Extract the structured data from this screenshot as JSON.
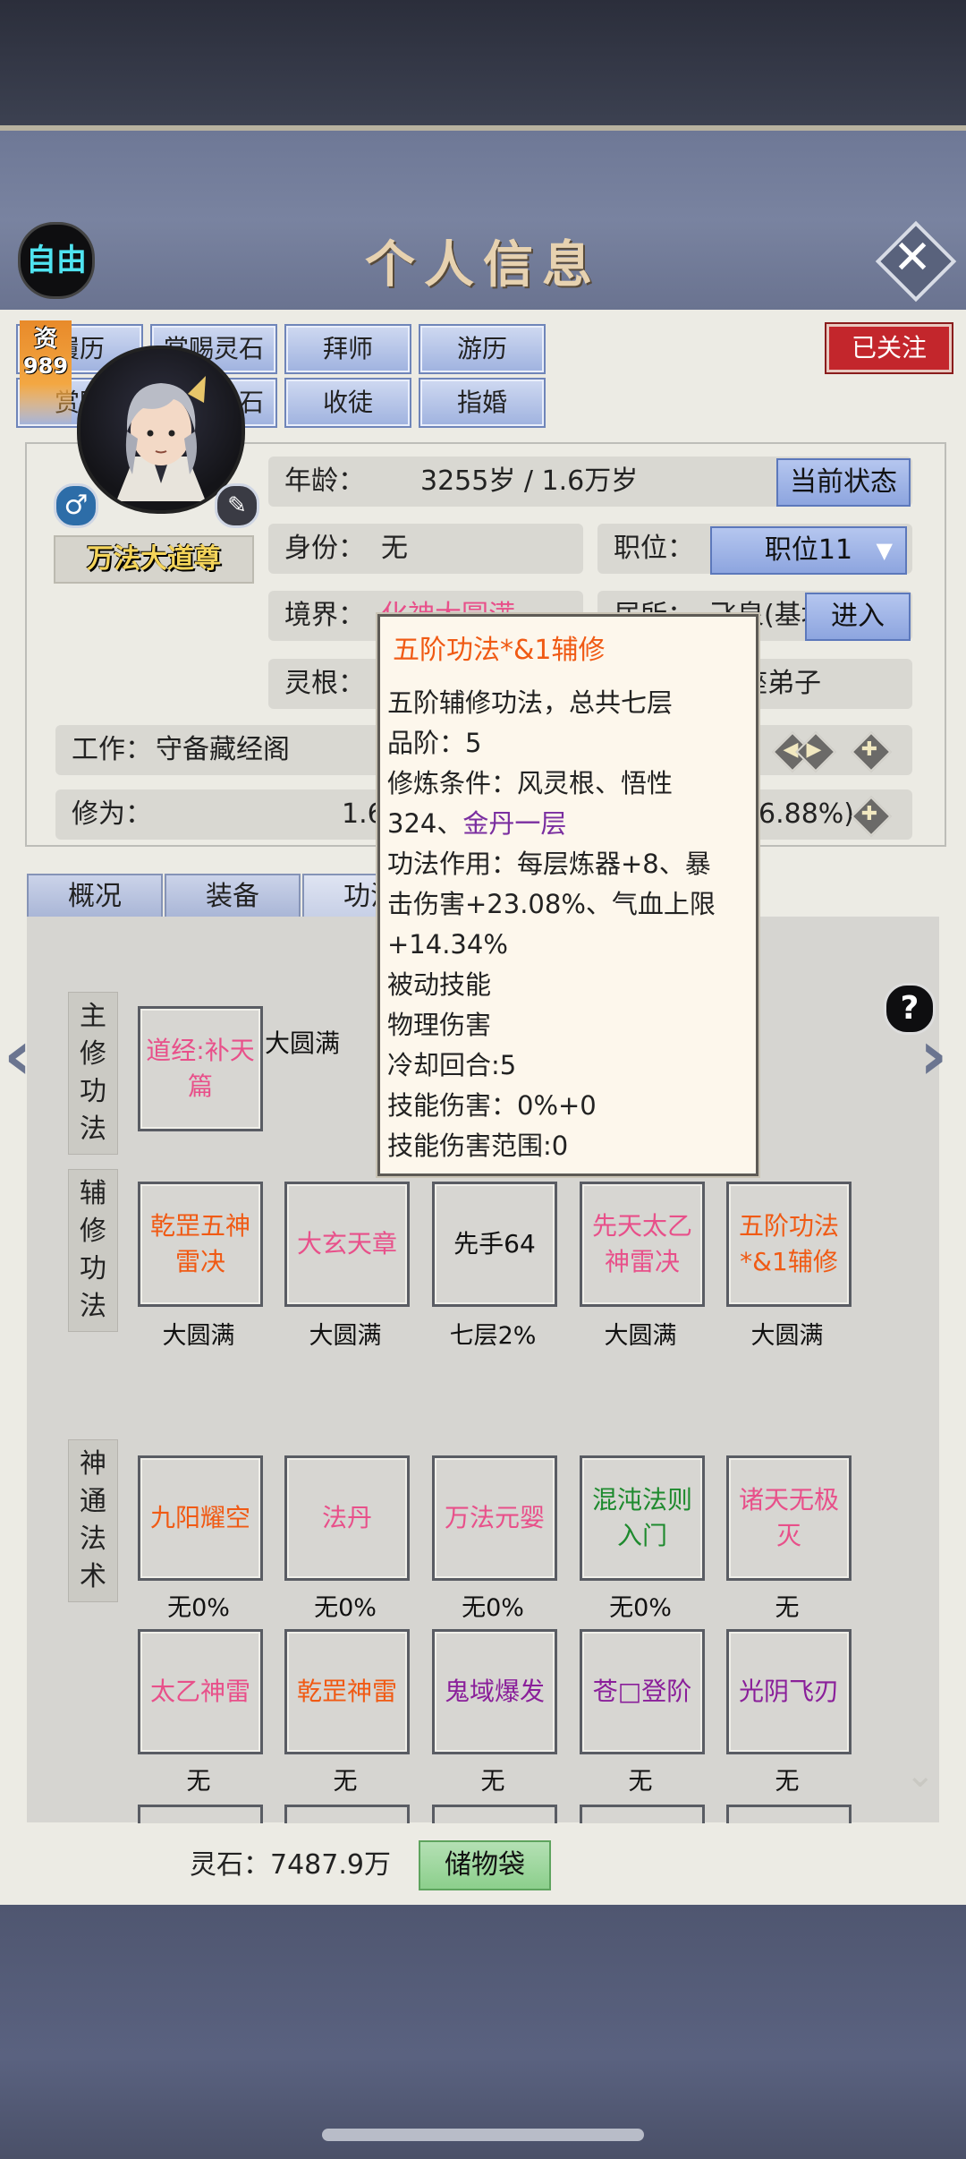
{
  "header": {
    "title": "个人信息",
    "freedom_label": "自由",
    "close_label": "✕"
  },
  "action_buttons": {
    "row1": [
      "履历",
      "赏赐灵石",
      "拜师",
      "游历"
    ],
    "row2": [
      "赏赐",
      "没收灵石",
      "收徒",
      "指婚"
    ],
    "follow": "已关注"
  },
  "profile": {
    "resource_label": "资",
    "resource_value": "989",
    "name": "万法大道尊",
    "gender_icon": "male-icon",
    "age_label": "年龄：",
    "age_value": "3255岁 / 1.6万岁",
    "status_button": "当前状态",
    "identity_label": "身份：",
    "identity_value": "无",
    "position_label": "职位：",
    "position_value": "职位11",
    "realm_label": "境界：",
    "realm_value": "化神大圆满",
    "residence_label": "居所：",
    "residence_value": "飞泉(基地)",
    "enter_button": "进入",
    "root_label": "灵根：",
    "disciple_value": "座弟子",
    "work_label": "工作：",
    "work_value": "守备藏经阁",
    "cultivation_label": "修为：",
    "cultivation_value_left": "1.6",
    "cultivation_value_right": "6.88%)"
  },
  "tabs": [
    "概况",
    "装备",
    "功法"
  ],
  "sections": {
    "main_label": "主修功法",
    "aux_label": "辅修功法",
    "magic_label": "神通法术"
  },
  "main_skill": {
    "name": "道经:补天篇",
    "status": "大圆满",
    "color": "#e8508a"
  },
  "aux_skills": [
    {
      "name": "乾罡五神雷决",
      "status": "大圆满",
      "color": "#f05a14"
    },
    {
      "name": "大玄天章",
      "status": "大圆满",
      "color": "#e8508a"
    },
    {
      "name": "先手64",
      "status": "七层2%",
      "color": "#111111"
    },
    {
      "name": "先天太乙神雷决",
      "status": "大圆满",
      "color": "#e8508a"
    },
    {
      "name": "五阶功法*&1辅修",
      "status": "大圆满",
      "color": "#f05a14"
    }
  ],
  "magic_skills_row1": [
    {
      "name": "九阳耀空",
      "status": "无0%",
      "color": "#f05a14"
    },
    {
      "name": "法丹",
      "status": "无0%",
      "color": "#e8508a"
    },
    {
      "name": "万法元婴",
      "status": "无0%",
      "color": "#e8508a"
    },
    {
      "name": "混沌法则入门",
      "status": "无0%",
      "color": "#1e8a2e"
    },
    {
      "name": "诸天无极灭",
      "status": "无",
      "color": "#e8508a"
    }
  ],
  "magic_skills_row2": [
    {
      "name": "太乙神雷",
      "status": "无",
      "color": "#e8508a"
    },
    {
      "name": "乾罡神雷",
      "status": "无",
      "color": "#f05a14"
    },
    {
      "name": "鬼域爆发",
      "status": "无",
      "color": "#8a1f9a"
    },
    {
      "name": "苍□登阶",
      "status": "无",
      "color": "#8a1f9a"
    },
    {
      "name": "光阴飞刃",
      "status": "无",
      "color": "#8a1f9a"
    }
  ],
  "tooltip": {
    "title": "五阶功法*&1辅修",
    "line1": "五阶辅修功法，总共七层",
    "line2": "品阶：5",
    "line3a": "修炼条件：风灵根、悟性",
    "line3b": "324、",
    "line3c": "金丹一层",
    "line4": "功法作用：每层炼器+8、暴",
    "line5": "击伤害+23.08%、气血上限",
    "line6": "+14.34%",
    "line7": "被动技能",
    "line8": "物理伤害",
    "line9": "冷却回合:5",
    "line10": "技能伤害：0%+0",
    "line11": "技能伤害范围:0"
  },
  "footer": {
    "spirit_stone": "灵石：7487.9万",
    "bag_button": "储物袋"
  },
  "colors": {
    "accent_blue": "#9fb2df",
    "follow_red": "#c3262c",
    "bag_green": "#8ccf8c"
  }
}
